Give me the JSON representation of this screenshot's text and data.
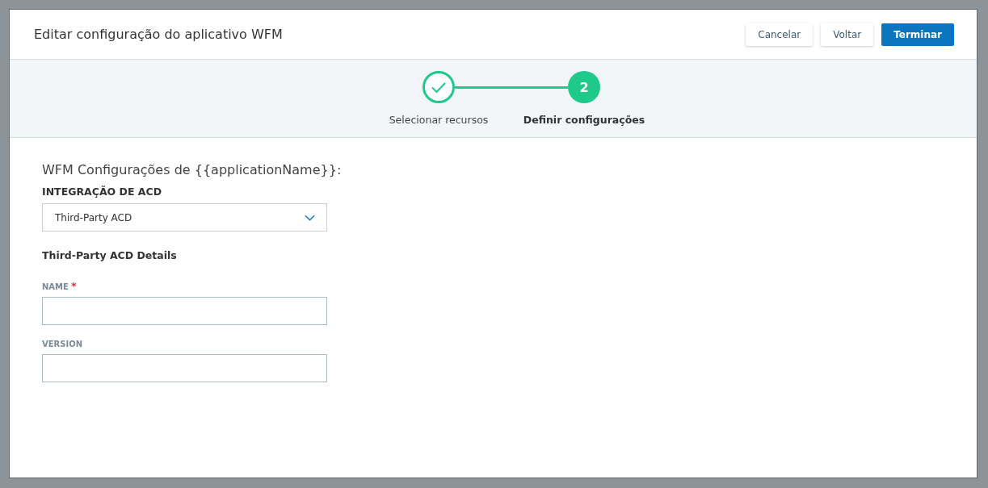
{
  "dialog": {
    "title": "Editar configuração do aplicativo WFM"
  },
  "buttons": [
    {
      "label": "Cancelar",
      "kind": "secondary"
    },
    {
      "label": "Voltar",
      "kind": "secondary"
    },
    {
      "label": "Terminar",
      "kind": "primary"
    }
  ],
  "steps": [
    {
      "label": "Selecionar recursos",
      "completed": true,
      "selected": false
    },
    {
      "number": "2",
      "label": "Definir configurações",
      "completed": false,
      "selected": true
    }
  ],
  "section_title": "WFM Configurações de {{applicationName}}:",
  "acd": {
    "label": "INTEGRAÇÃO DE ACD",
    "value": "Third-Party ACD"
  },
  "details_title": "Third-Party ACD Details",
  "fields": [
    {
      "label": "NAME",
      "required_mark": "*"
    },
    {
      "label": "VERSION"
    }
  ]
}
